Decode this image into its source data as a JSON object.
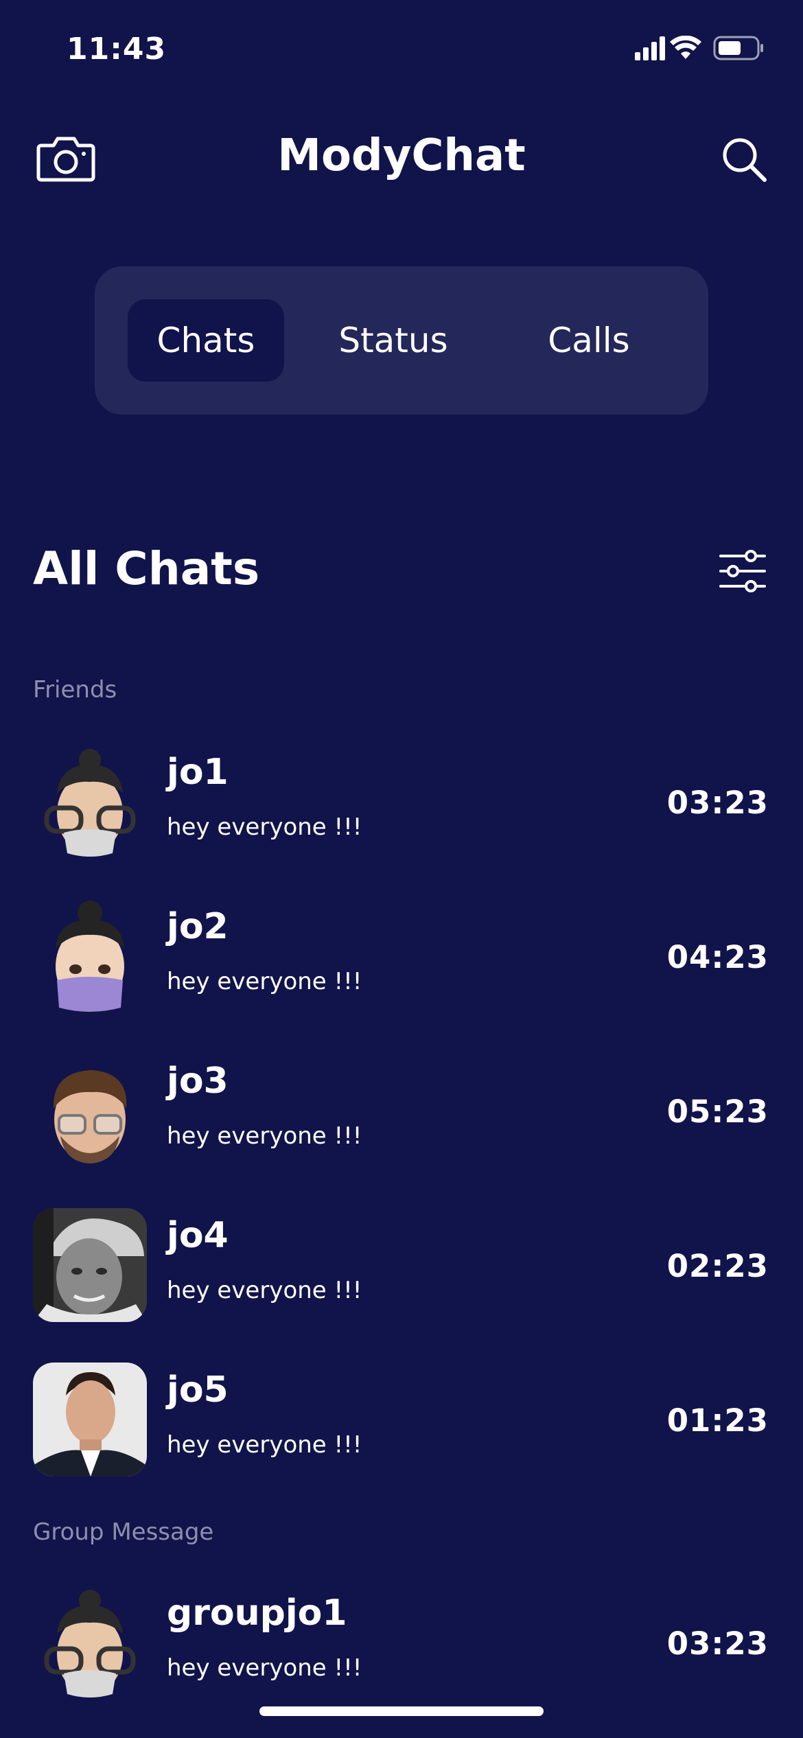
{
  "status_bar": {
    "time": "11:43"
  },
  "header": {
    "title": "ModyChat"
  },
  "tabs": [
    {
      "label": "Chats",
      "active": true
    },
    {
      "label": "Status",
      "active": false
    },
    {
      "label": "Calls",
      "active": false
    }
  ],
  "section": {
    "title": "All Chats"
  },
  "groups": {
    "friends_label": "Friends",
    "group_label": "Group Message"
  },
  "chats": [
    {
      "name": "jo1",
      "message": "hey everyone !!!",
      "time": "03:23",
      "avatar": "memoji-glasses-bun"
    },
    {
      "name": "jo2",
      "message": "hey everyone !!!",
      "time": "04:23",
      "avatar": "memoji-mask-bun"
    },
    {
      "name": "jo3",
      "message": "hey everyone !!!",
      "time": "05:23",
      "avatar": "memoji-glasses-beard"
    },
    {
      "name": "jo4",
      "message": "hey everyone !!!",
      "time": "02:23",
      "avatar": "photo-bw-cap"
    },
    {
      "name": "jo5",
      "message": "hey everyone !!!",
      "time": "01:23",
      "avatar": "photo-suit"
    }
  ],
  "group_chats": [
    {
      "name": "groupjo1",
      "message": "hey everyone !!!",
      "time": "03:23",
      "avatar": "memoji-glasses-bun"
    }
  ],
  "colors": {
    "background": "#11144a",
    "segmented_bg": "#23275a",
    "muted_text": "#8d90ad"
  }
}
